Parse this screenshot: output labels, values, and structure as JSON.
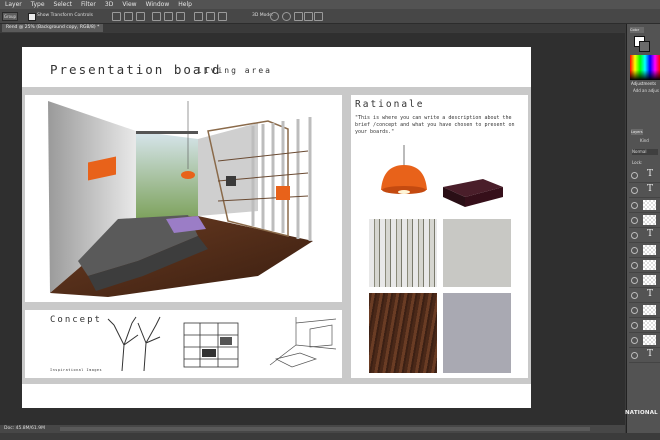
{
  "menu": [
    "Layer",
    "Type",
    "Select",
    "Filter",
    "3D",
    "View",
    "Window",
    "Help"
  ],
  "options": {
    "auto_select": "Group",
    "show_transform": "Show Transform Controls",
    "mode_label": "3D Mode:"
  },
  "document_tab": "Rend @ 25% (Background copy, RGB/8) *",
  "status_text": "Doc: 45.8M/61.9M",
  "panels": {
    "color_tab": "Color",
    "adjustments_tab": "Adjustments",
    "add_adjustment": "Add an adjus",
    "layers_tab": "Layers",
    "kind": "Kind",
    "blend_mode": "Normal",
    "lock": "Lock:",
    "watermark": "NATIONAL"
  },
  "board": {
    "title": "Presentation board",
    "subtitle": "living area",
    "rationale_heading": "Rationale",
    "rationale_text": "\"This is where you can write a description about the brief /concept and what you have chosen to present on your boards.\"",
    "concept_heading": "Concept",
    "inspiration_label": "Inspirational Images"
  },
  "colors": {
    "accent_orange": "#e8621a",
    "panel_gray": "#535353",
    "board_border": "#c9c9c9"
  }
}
